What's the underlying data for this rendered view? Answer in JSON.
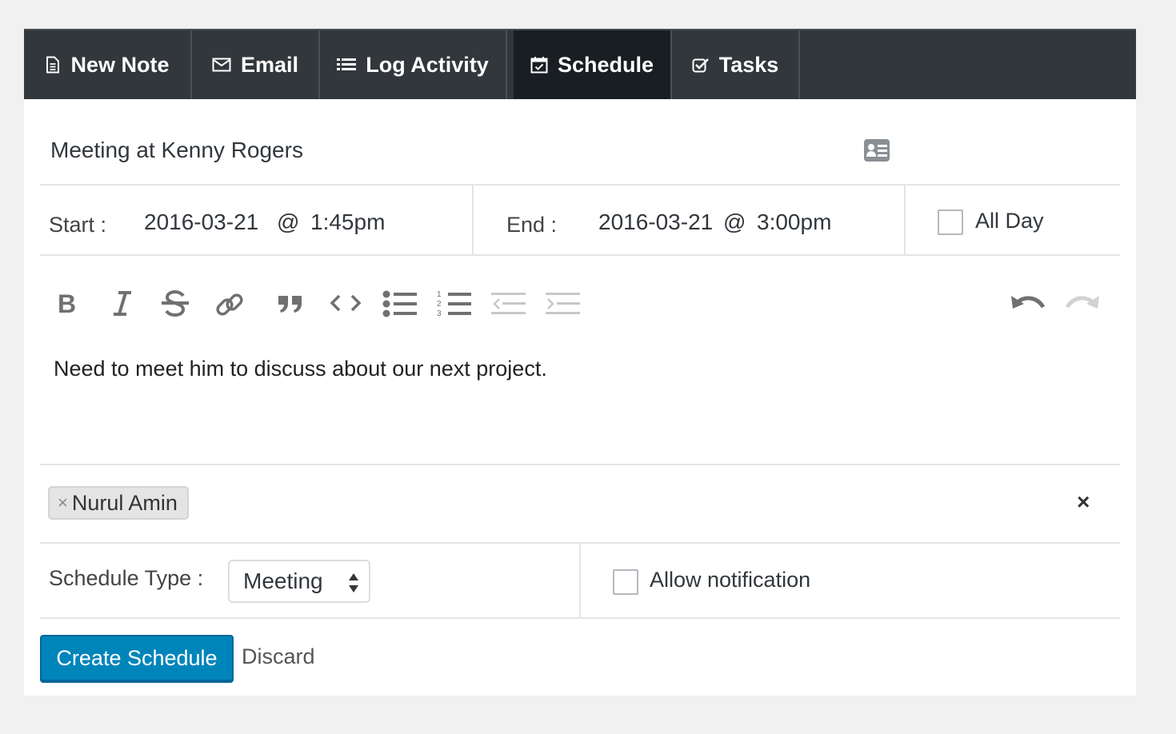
{
  "tabs": [
    {
      "label": "New Note",
      "icon": "file-text-icon",
      "active": false
    },
    {
      "label": "Email",
      "icon": "envelope-icon",
      "active": false
    },
    {
      "label": "Log Activity",
      "icon": "list-icon",
      "active": false
    },
    {
      "label": "Schedule",
      "icon": "calendar-check-icon",
      "active": true
    },
    {
      "label": "Tasks",
      "icon": "check-square-icon",
      "active": false
    }
  ],
  "schedule": {
    "title": "Meeting at Kenny Rogers",
    "start_label": "Start :",
    "start_date": "2016-03-21",
    "start_at": "@",
    "start_time": "1:45pm",
    "end_label": "End :",
    "end_date": "2016-03-21",
    "end_at": "@",
    "end_time": "3:00pm",
    "all_day_label": "All Day",
    "all_day_checked": false
  },
  "editor": {
    "toolbar": [
      "bold-icon",
      "italic-icon",
      "strikethrough-icon",
      "link-icon",
      "blockquote-icon",
      "code-icon",
      "bullet-list-icon",
      "numbered-list-icon",
      "outdent-icon",
      "indent-icon",
      "undo-icon",
      "redo-icon"
    ],
    "body": "Need to meet him to discuss about our next project."
  },
  "attendees": {
    "tags": [
      {
        "name": "Nurul Amin",
        "remove": "×"
      }
    ],
    "clear": "×"
  },
  "type": {
    "label": "Schedule Type :",
    "selected": "Meeting",
    "notify_label": "Allow notification",
    "notify_checked": false
  },
  "actions": {
    "create": "Create Schedule",
    "discard": "Discard"
  },
  "colors": {
    "tab_bar": "#32373c",
    "tab_active": "#191e23",
    "primary": "#0085ba",
    "background": "#f1f1f1"
  }
}
